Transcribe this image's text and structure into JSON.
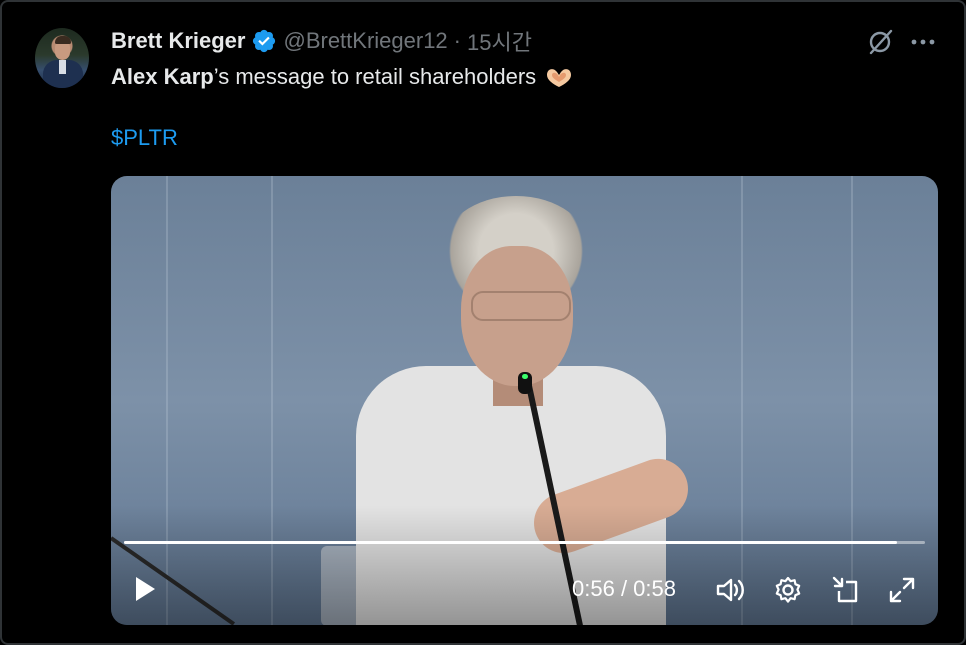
{
  "tweet": {
    "author_name": "Brett Krieger",
    "handle": "@BrettKrieger12",
    "separator": "·",
    "time_ago": "15시간",
    "text_bold": "Alex Karp",
    "text_rest": "’s message to retail shareholders",
    "cashtag": "$PLTR"
  },
  "video": {
    "current_time": "0:56",
    "time_separator": " / ",
    "duration": "0:58",
    "progress": 0.9655
  },
  "icons": {
    "verified": "verified-badge-icon",
    "grok": "grok-icon",
    "more": "more-icon",
    "emoji": "heart-hands-icon",
    "play": "play-icon",
    "volume": "volume-icon",
    "settings": "gear-icon",
    "pip": "picture-in-picture-icon",
    "fullscreen": "fullscreen-icon"
  },
  "colors": {
    "accent": "#1d9bf0",
    "muted": "#71767b",
    "text": "#e7e9ea",
    "background": "#000000"
  }
}
